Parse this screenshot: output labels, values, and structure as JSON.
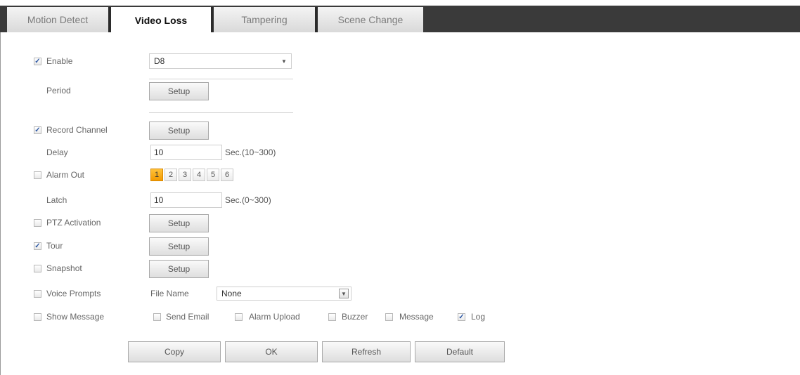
{
  "tabs": [
    "Motion Detect",
    "Video Loss",
    "Tampering",
    "Scene Change"
  ],
  "enable": {
    "label": "Enable",
    "checked": true,
    "channel": "D8"
  },
  "period": {
    "label": "Period",
    "button": "Setup"
  },
  "record_channel": {
    "label": "Record Channel",
    "checked": true,
    "button": "Setup"
  },
  "delay": {
    "label": "Delay",
    "value": "10",
    "unit": "Sec.(10~300)"
  },
  "alarm_out": {
    "label": "Alarm Out",
    "checked": false,
    "channels": [
      "1",
      "2",
      "3",
      "4",
      "5",
      "6"
    ],
    "active": "1"
  },
  "latch": {
    "label": "Latch",
    "value": "10",
    "unit": "Sec.(0~300)"
  },
  "ptz": {
    "label": "PTZ Activation",
    "checked": false,
    "button": "Setup"
  },
  "tour": {
    "label": "Tour",
    "checked": true,
    "button": "Setup"
  },
  "snapshot": {
    "label": "Snapshot",
    "checked": false,
    "button": "Setup"
  },
  "voice": {
    "label": "Voice Prompts",
    "checked": false,
    "file_label": "File Name",
    "file_value": "None"
  },
  "show_message": {
    "label": "Show Message",
    "checked": false
  },
  "extras": [
    {
      "label": "Send Email",
      "checked": false
    },
    {
      "label": "Alarm Upload",
      "checked": false
    },
    {
      "label": "Buzzer",
      "checked": false
    },
    {
      "label": "Message",
      "checked": false
    },
    {
      "label": "Log",
      "checked": true
    }
  ],
  "footer_buttons": [
    "Copy",
    "OK",
    "Refresh",
    "Default"
  ],
  "check_mark": "✓",
  "colors": {
    "tabbar": "#3a3a3a",
    "active_channel": "#f5a400"
  }
}
